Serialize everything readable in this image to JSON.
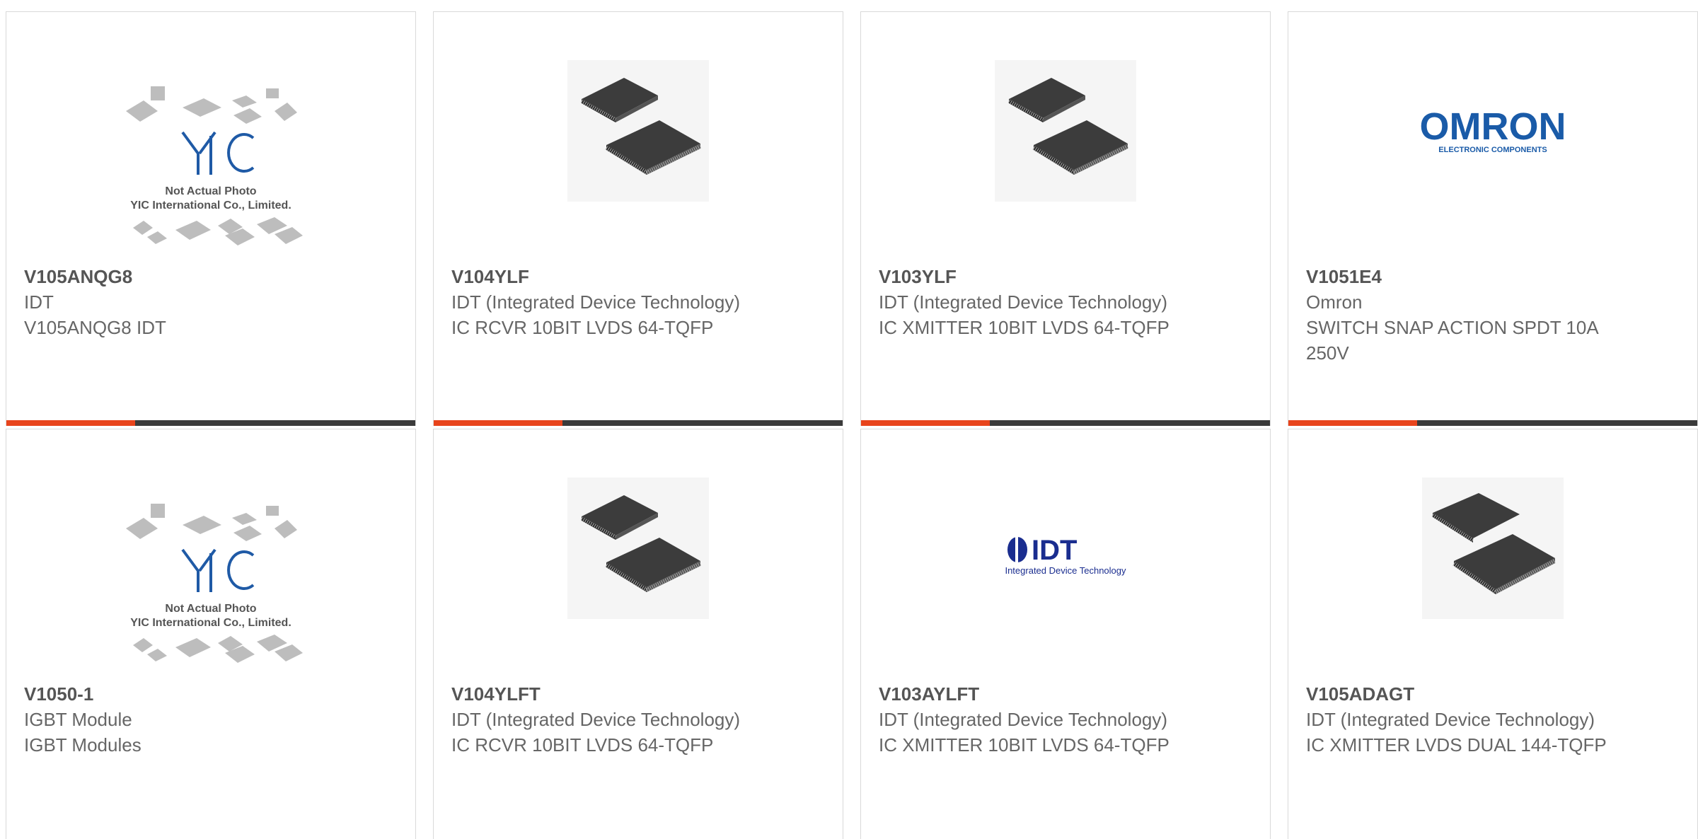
{
  "products": [
    {
      "part": "V105ANQG8",
      "maker": "IDT",
      "desc": "V105ANQG8 IDT",
      "image": "yic-placeholder"
    },
    {
      "part": "V104YLF",
      "maker": "IDT (Integrated Device Technology)",
      "desc": "IC RCVR 10BIT LVDS 64-TQFP",
      "image": "tqfp-chip"
    },
    {
      "part": "V103YLF",
      "maker": "IDT (Integrated Device Technology)",
      "desc": "IC XMITTER 10BIT LVDS 64-TQFP",
      "image": "tqfp-chip"
    },
    {
      "part": "V1051E4",
      "maker": "Omron",
      "desc": "SWITCH SNAP ACTION SPDT 10A 250V",
      "image": "omron-logo"
    },
    {
      "part": "V1050-1",
      "maker": "IGBT Module",
      "desc": "IGBT Modules",
      "image": "yic-placeholder"
    },
    {
      "part": "V104YLFT",
      "maker": "IDT (Integrated Device Technology)",
      "desc": "IC RCVR 10BIT LVDS 64-TQFP",
      "image": "tqfp-chip"
    },
    {
      "part": "V103AYLFT",
      "maker": "IDT (Integrated Device Technology)",
      "desc": "IC XMITTER 10BIT LVDS 64-TQFP",
      "image": "idt-logo"
    },
    {
      "part": "V105ADAGT",
      "maker": "IDT (Integrated Device Technology)",
      "desc": "IC XMITTER LVDS DUAL 144-TQFP",
      "image": "tqfp-chip-large"
    }
  ],
  "placeholder": {
    "logo": "YIC",
    "line1": "Not Actual Photo",
    "line2": "YIC International Co., Limited."
  },
  "logos": {
    "omron_name": "OMRON",
    "omron_sub": "ELECTRONIC COMPONENTS",
    "idt_name": "IDT",
    "idt_sub": "Integrated Device Technology"
  },
  "colors": {
    "accent": "#e8441c",
    "bar": "#3a3a3a",
    "omron_blue": "#1a5ba8",
    "idt_blue": "#1a2d8f"
  }
}
